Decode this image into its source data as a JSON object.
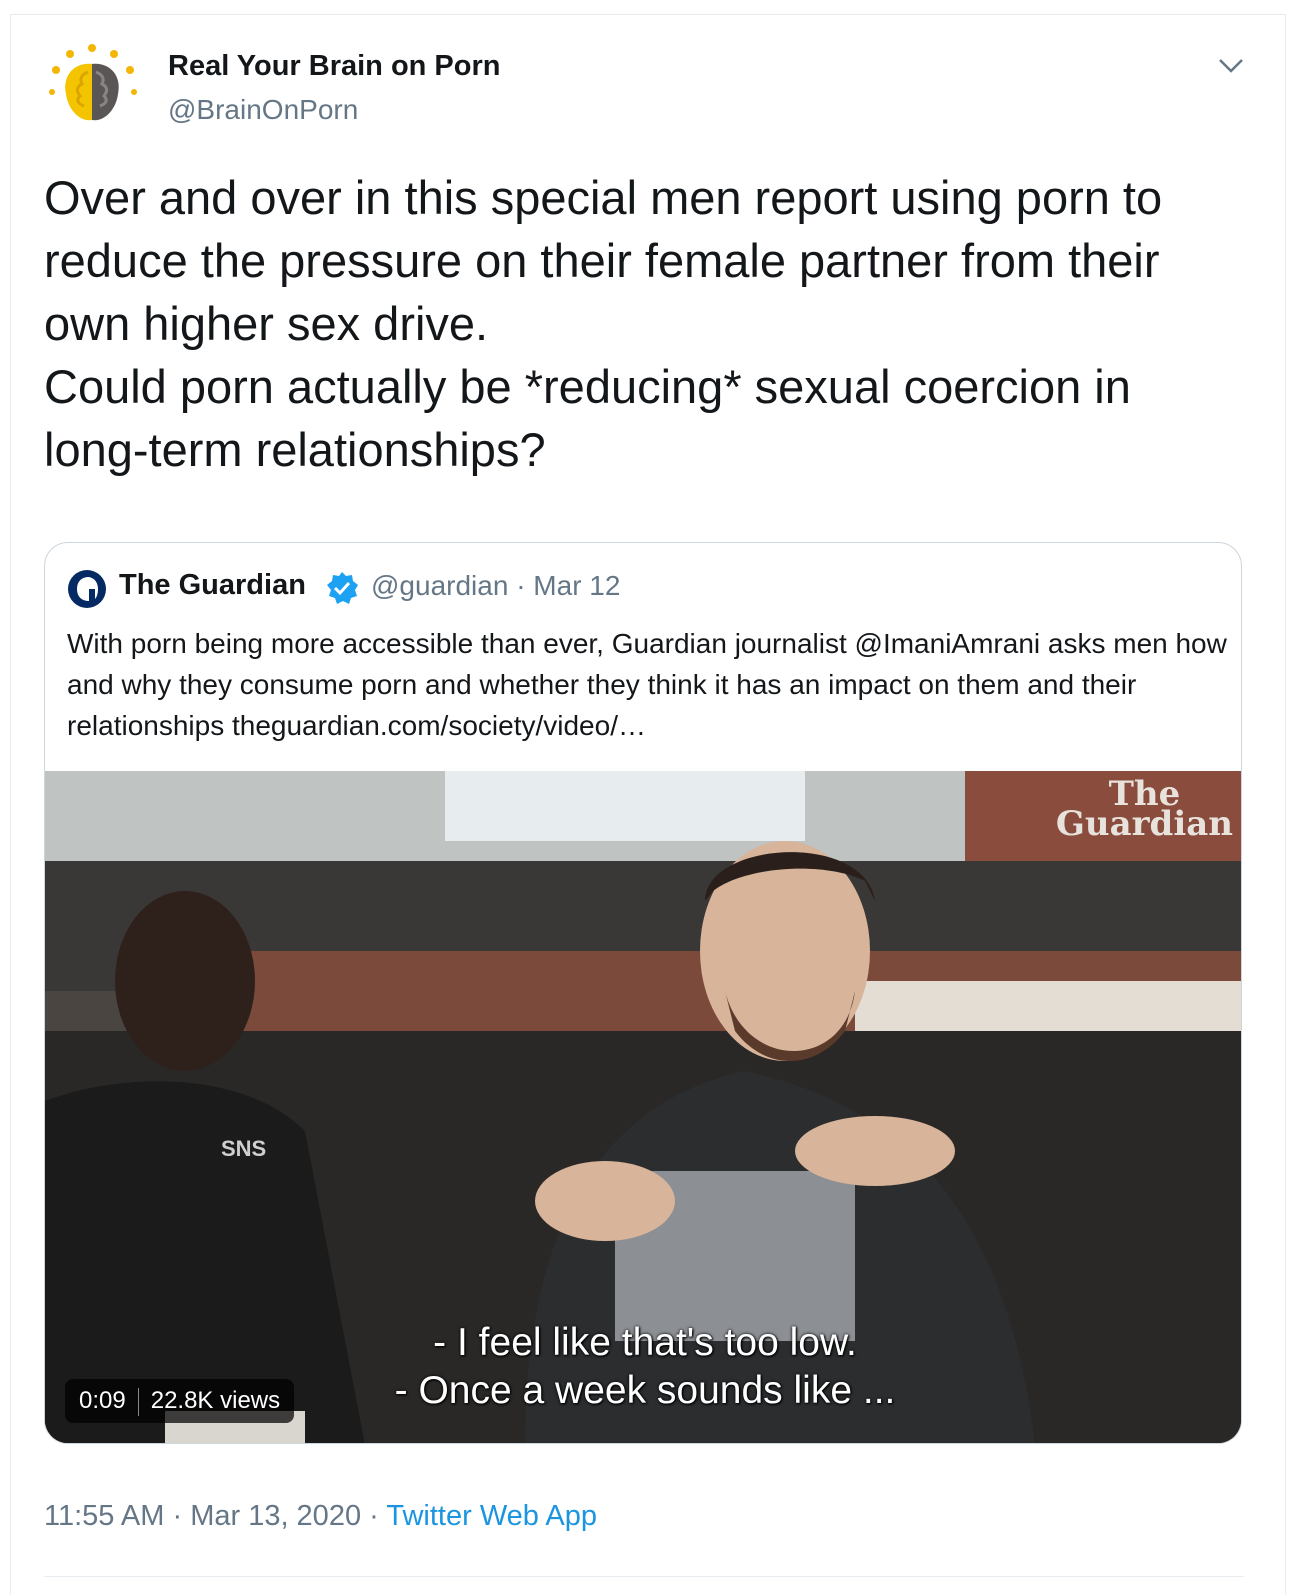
{
  "tweet": {
    "display_name": "Real Your Brain on Porn",
    "handle": "@BrainOnPorn",
    "text": "Over and over in this special men report using porn to reduce the pressure on their female partner from their own higher sex drive.\nCould porn actually be *reducing* sexual coercion in long-term relationships?",
    "time": "11:55 AM",
    "date": "Mar 13, 2020",
    "source": "Twitter Web App",
    "dot": "·"
  },
  "quoted": {
    "display_name": "The Guardian",
    "handle": "@guardian",
    "date": "Mar 12",
    "text": "With porn being more accessible than ever, Guardian journalist @ImaniAmrani  asks men how and why they consume porn and whether they think it has an impact on them and their relationships theguardian.com/society/video/…",
    "video": {
      "watermark_line1": "The",
      "watermark_line2": "Guardian",
      "subtitle_line1": "- I feel like that's too low.",
      "subtitle_line2": "- Once a week sounds like ...",
      "duration": "0:09",
      "views": "22.8K views",
      "sweater_text": "SNS"
    }
  },
  "icons": [
    "brain-avatar-icon",
    "chevron-down-icon",
    "guardian-logo-icon",
    "verified-badge-icon"
  ],
  "colors": {
    "link": "#1b95e0",
    "secondary": "#657786",
    "border": "#ccd6dd",
    "verified": "#1da1f2"
  }
}
